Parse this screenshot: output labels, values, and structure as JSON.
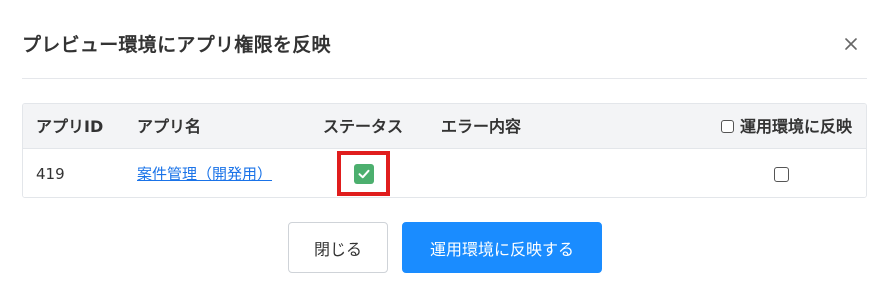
{
  "dialog": {
    "title": "プレビュー環境にアプリ権限を反映",
    "close_icon": "close-icon"
  },
  "table": {
    "columns": {
      "app_id": "アプリID",
      "app_name": "アプリ名",
      "status": "ステータス",
      "error": "エラー内容",
      "apply": "運用環境に反映"
    },
    "rows": [
      {
        "app_id": "419",
        "app_name": "案件管理（開発用）",
        "status_icon": "check-success-icon",
        "error": "",
        "apply_checked": false
      }
    ],
    "apply_all_checked": false
  },
  "buttons": {
    "close_label": "閉じる",
    "apply_label": "運用環境に反映する"
  },
  "colors": {
    "primary": "#1a8cff",
    "link": "#1a73e8",
    "success": "#4caf6e",
    "highlight": "#e01d1d"
  }
}
